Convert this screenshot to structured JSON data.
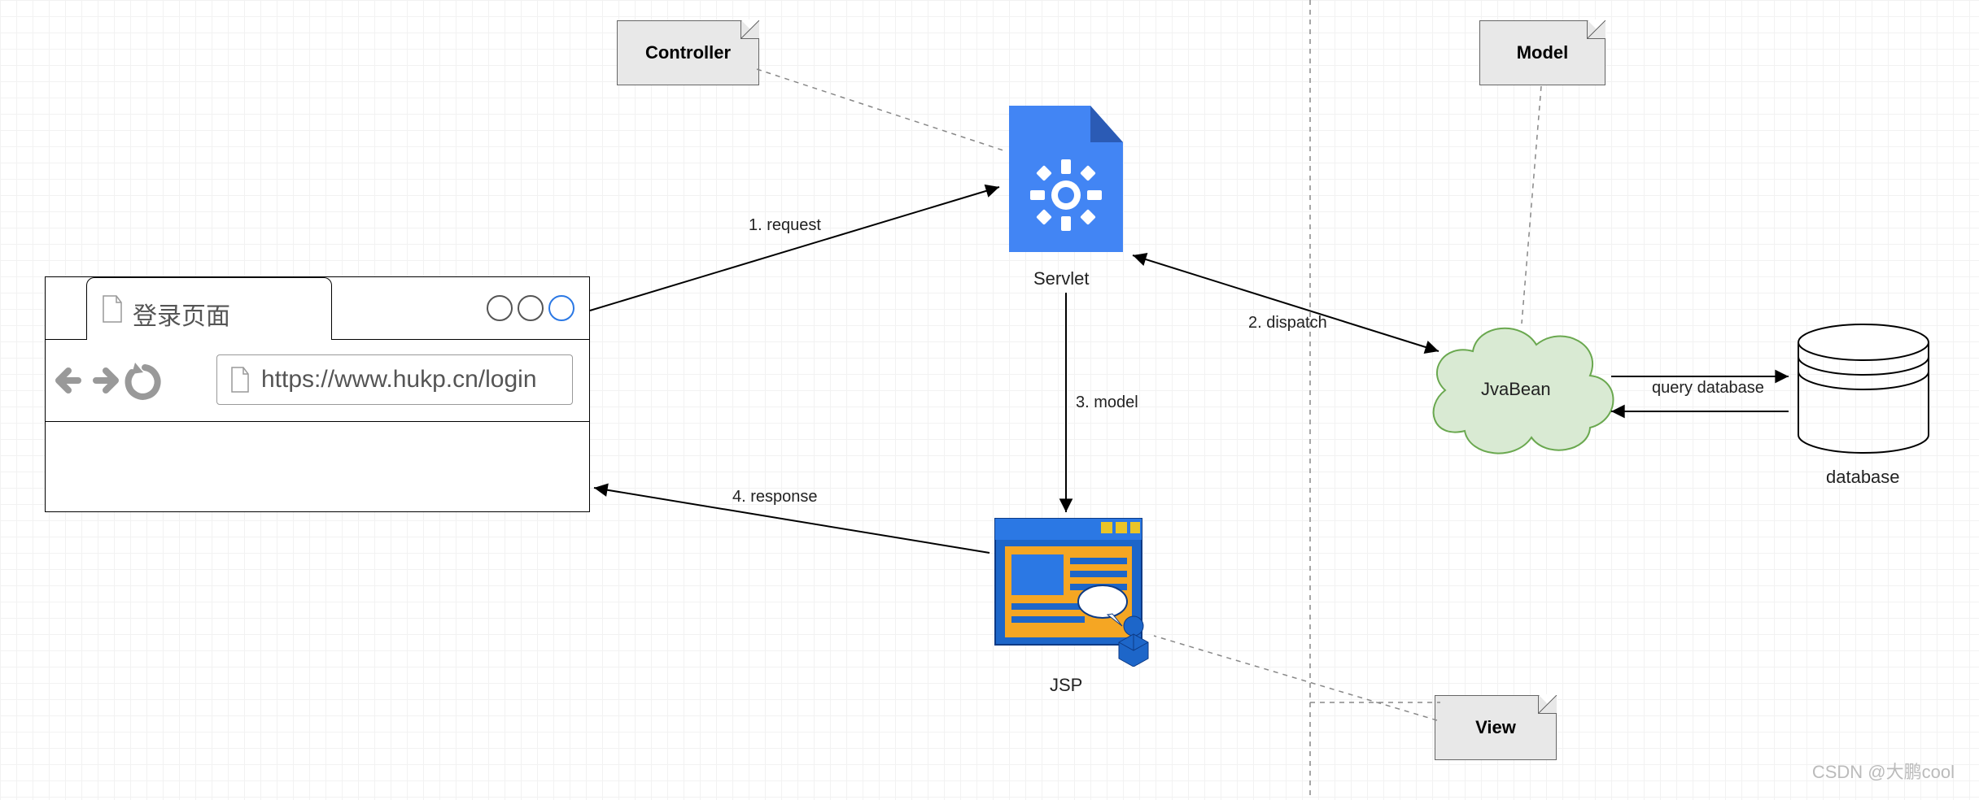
{
  "notes": {
    "controller": "Controller",
    "model": "Model",
    "view": "View"
  },
  "browser": {
    "tab_title": "登录页面",
    "url": "https://www.hukp.cn/login"
  },
  "nodes": {
    "servlet": "Servlet",
    "jsp": "JSP",
    "javabean": "JvaBean",
    "database": "database"
  },
  "edges": {
    "e1": "1. request",
    "e2": "2. dispatch",
    "e3": "3. model",
    "e4": "4. response",
    "e5": "query database"
  },
  "watermark": "CSDN @大鹏cool"
}
